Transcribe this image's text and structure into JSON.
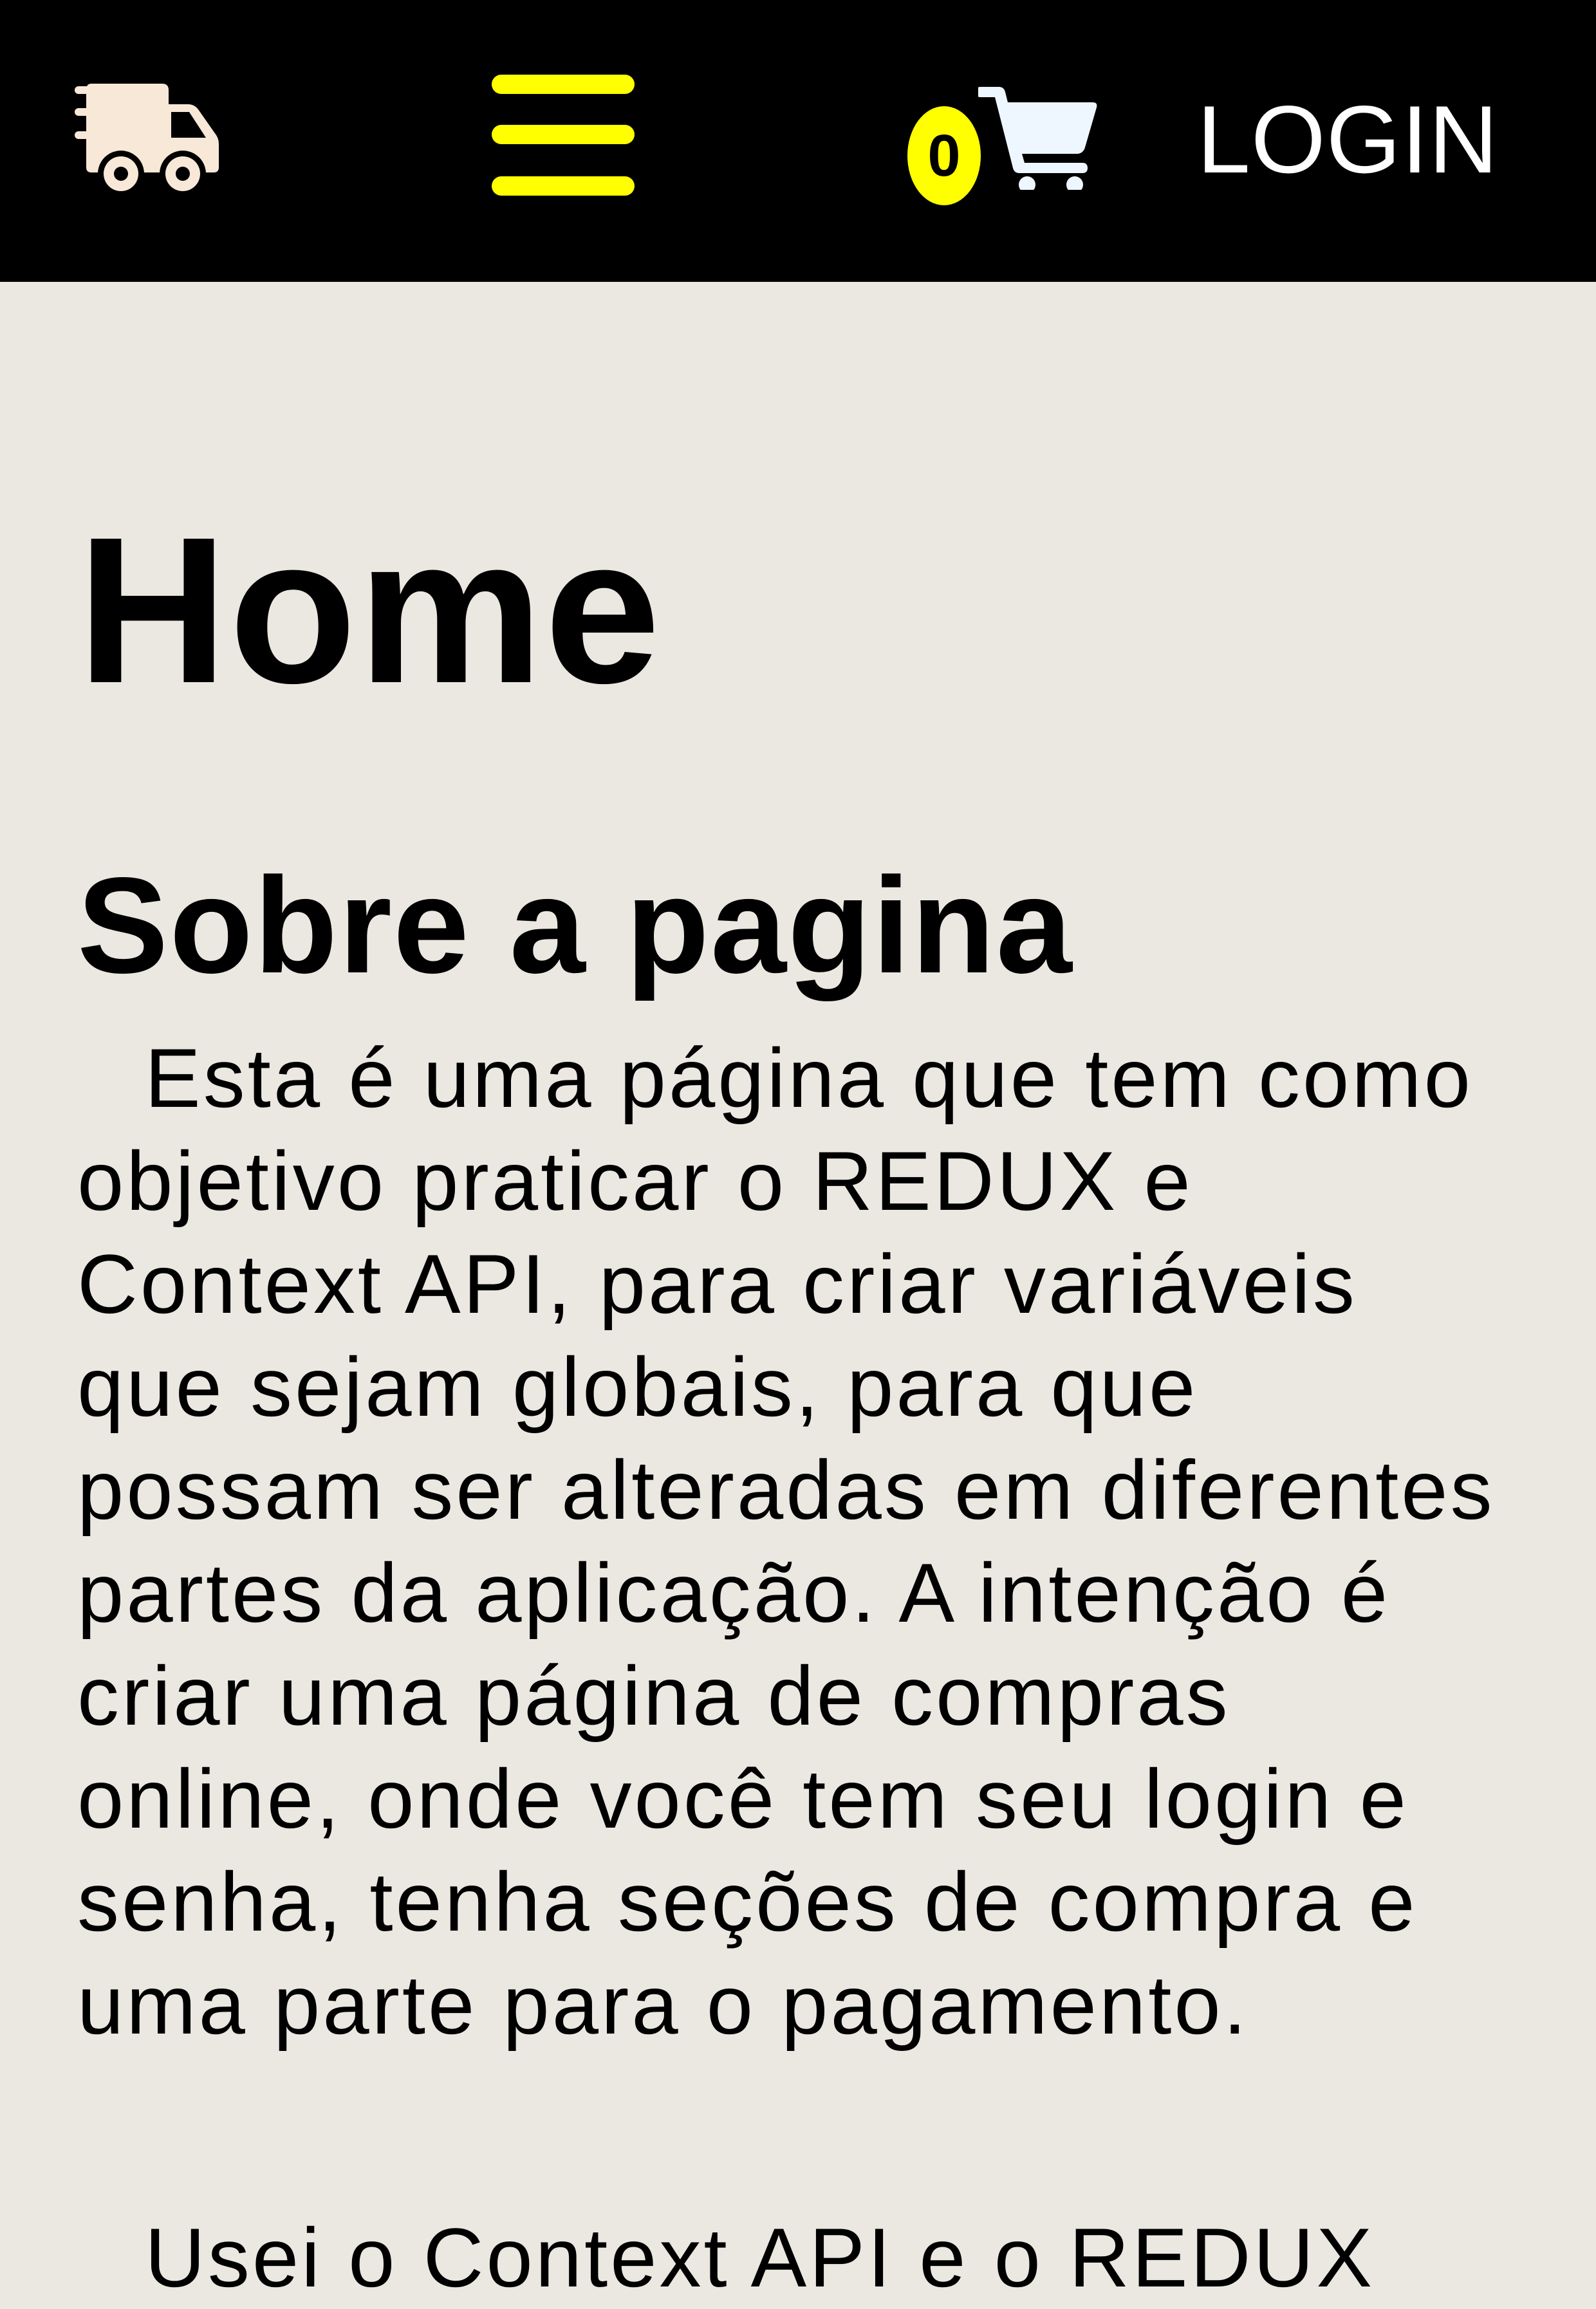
{
  "navbar": {
    "logo_icon": "delivery-truck-icon",
    "menu_icon": "hamburger-menu-icon",
    "cart_icon": "shopping-cart-icon",
    "cart_count": "0",
    "login_label": "LOGIN",
    "colors": {
      "background": "#000000",
      "accent": "#ffff00",
      "truck": "#f8e8d8",
      "cart": "#eef6ff"
    }
  },
  "main": {
    "page_title": "Home",
    "section_title": "Sobre a pagina",
    "paragraph": "Esta é uma página que tem como objetivo praticar o REDUX e Context API, para criar variáveis que sejam globais, para que possam ser alteradas em diferentes partes da aplicação. A intenção é criar uma página de compras online, onde você tem seu login e senha, tenha seções de compra e uma parte para o pagamento.",
    "paragraph_2_partial": "Usei o Context API e o REDUX",
    "background": "#ebe8e1"
  }
}
